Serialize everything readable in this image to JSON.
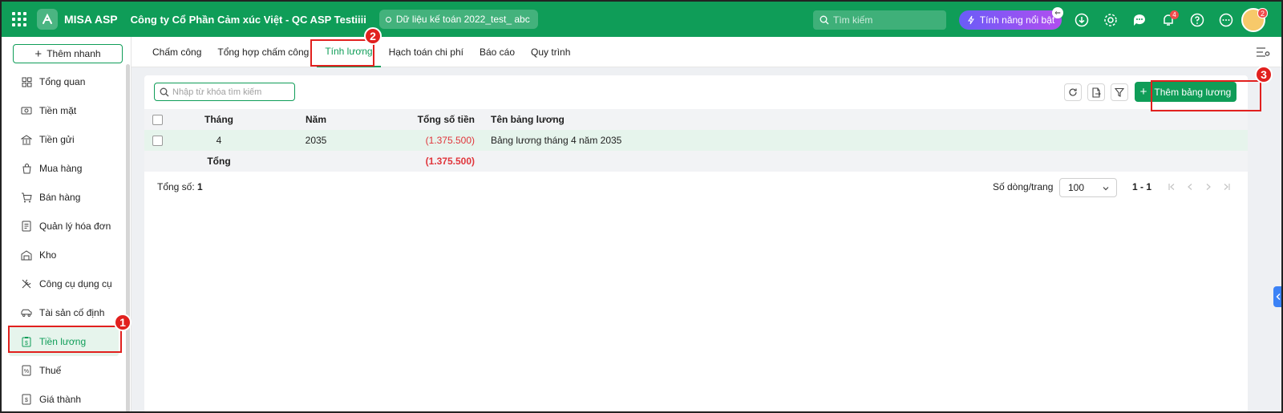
{
  "topbar": {
    "app_name": "MISA ASP",
    "company": "Công ty Cổ Phần Cảm xúc Việt - QC ASP Testiiii",
    "database": "Dữ liệu kế toán 2022_test_ abc",
    "search_placeholder": "Tìm kiếm",
    "feature_button": "Tính năng nổi bật",
    "notification_count": "4",
    "avatar_badge": "2",
    "icons": [
      "apps-grid-icon",
      "logo-icon",
      "search-icon",
      "sparkle-icon",
      "download-icon",
      "gear-icon",
      "chat-icon",
      "bell-icon",
      "help-icon",
      "more-icon"
    ]
  },
  "sidebar": {
    "quick_add": "Thêm nhanh",
    "items": [
      {
        "label": "Tổng quan",
        "icon": "dashboard-icon"
      },
      {
        "label": "Tiền mặt",
        "icon": "cash-icon"
      },
      {
        "label": "Tiền gửi",
        "icon": "bank-icon"
      },
      {
        "label": "Mua hàng",
        "icon": "shopping-bag-icon"
      },
      {
        "label": "Bán hàng",
        "icon": "cart-icon"
      },
      {
        "label": "Quản lý hóa đơn",
        "icon": "invoice-icon"
      },
      {
        "label": "Kho",
        "icon": "warehouse-icon"
      },
      {
        "label": "Công cụ dụng cụ",
        "icon": "tools-icon"
      },
      {
        "label": "Tài sản cố định",
        "icon": "vehicle-icon"
      },
      {
        "label": "Tiền lương",
        "icon": "salary-icon",
        "active": true
      },
      {
        "label": "Thuế",
        "icon": "tax-icon"
      },
      {
        "label": "Giá thành",
        "icon": "cost-icon"
      }
    ]
  },
  "tabs": [
    {
      "label": "Chấm công"
    },
    {
      "label": "Tổng hợp chấm công"
    },
    {
      "label": "Tính lương",
      "active": true
    },
    {
      "label": "Hạch toán chi phí"
    },
    {
      "label": "Báo cáo"
    },
    {
      "label": "Quy trình"
    }
  ],
  "toolbar": {
    "search_placeholder": "Nhập từ khóa tìm kiếm",
    "add_button": "Thêm bảng lương"
  },
  "table": {
    "headers": {
      "month": "Tháng",
      "year": "Năm",
      "total": "Tổng số tiền",
      "name": "Tên bảng lương"
    },
    "rows": [
      {
        "month": "4",
        "year": "2035",
        "total": "(1.375.500)",
        "name": "Bảng lương tháng 4 năm 2035"
      }
    ],
    "footer": {
      "label": "Tổng",
      "total": "(1.375.500)"
    }
  },
  "pager": {
    "total_label": "Tổng số:",
    "total_value": "1",
    "rows_label": "Số dòng/trang",
    "rows_value": "100",
    "range": "1 - 1"
  },
  "markers": {
    "m1": "1",
    "m2": "2",
    "m3": "3"
  },
  "colors": {
    "brand": "#0f9d58",
    "negative": "#e0353b",
    "marker": "#e1201e"
  }
}
